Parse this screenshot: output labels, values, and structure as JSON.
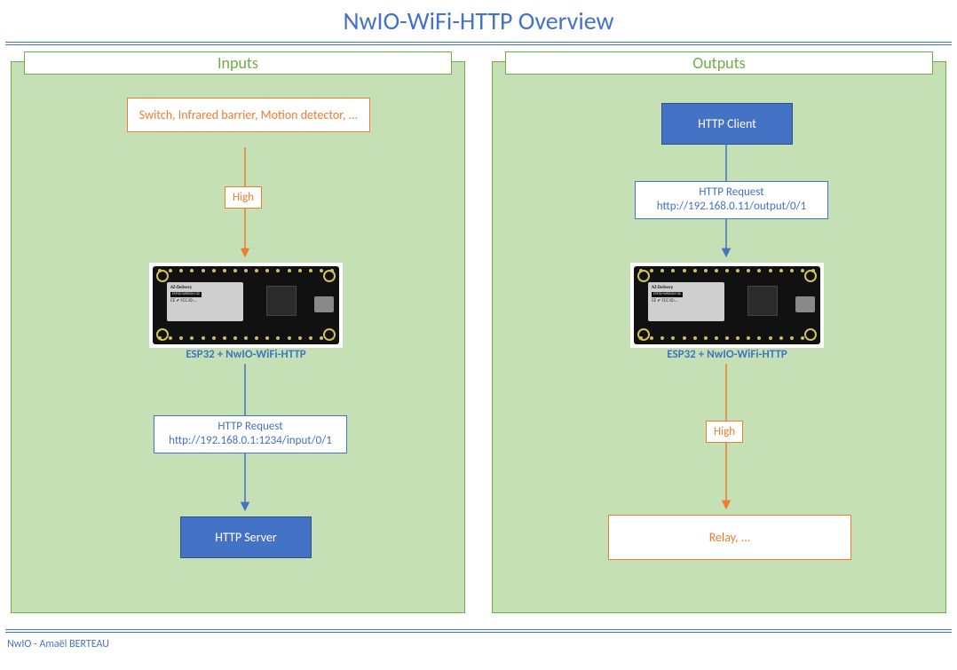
{
  "title": "NwIO-WiFi-HTTP Overview",
  "footer": "NwIO - Amaël BERTEAU",
  "inputs": {
    "header": "Inputs",
    "source_box": "Switch, Infrared barrier, Motion detector, ...",
    "signal": "High",
    "device_caption": "ESP32 + NwIO-WiFi-HTTP",
    "request_label": "HTTP Request",
    "request_url": "http://192.168.0.1:1234/input/0/1",
    "target": "HTTP Server"
  },
  "outputs": {
    "header": "Outputs",
    "source_box": "HTTP Client",
    "request_label": "HTTP Request",
    "request_url": "http://192.168.0.11/output/0/1",
    "device_caption": "ESP32 + NwIO-WiFi-HTTP",
    "signal": "High",
    "target": "Relay, ..."
  },
  "board": {
    "brand": "AZ-Delivery",
    "model": "ESP32-WROOM-32"
  },
  "colors": {
    "accent_blue": "#4472C4",
    "accent_green": "#70ad47",
    "panel_bg": "#c5e0b4",
    "accent_orange": "#ed7d31"
  }
}
